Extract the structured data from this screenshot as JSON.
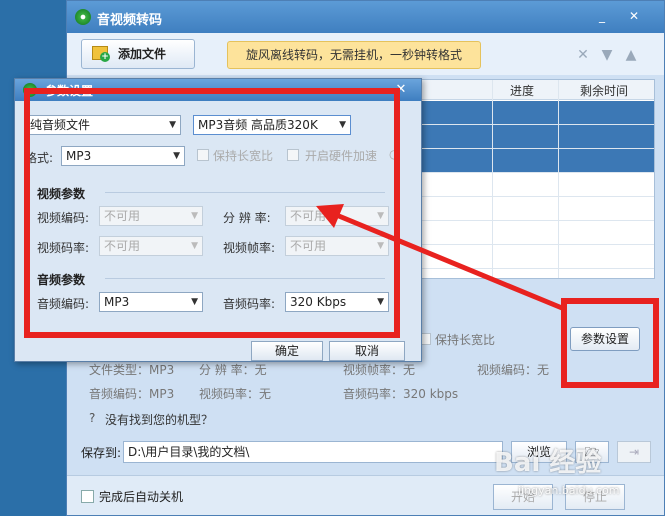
{
  "app": {
    "title": "音视频转码",
    "window_controls": [
      "_",
      "✕"
    ]
  },
  "toolbar": {
    "add_file_label": "添加文件",
    "banner_text": "旋风离线转码，无需挂机，一秒钟转格式",
    "icons": [
      "close-x-icon",
      "arrow-down-icon",
      "arrow-up-icon"
    ]
  },
  "file_grid": {
    "headers": [
      "进度",
      "剩余时间"
    ],
    "selected_rows": 3,
    "total_rows": 8
  },
  "param_panel": {
    "keep_ratio_label": "保持长宽比",
    "paramset_button": "参数设置",
    "line1": [
      "文件类型：MP3",
      "分 辨 率：无",
      "视频帧率：无",
      "视频编码：无"
    ],
    "line2": [
      "音频编码：MP3",
      "视频码率：无",
      "音频码率：320 kbps"
    ],
    "help_text": "没有找到您的机型？"
  },
  "save": {
    "label": "保存到:",
    "path": "D:\\用户目录\\我的文档\\",
    "browse_label": "浏览"
  },
  "bottom": {
    "shutdown_label": "完成后自动关机",
    "start_label": "开始",
    "stop_label": "停止"
  },
  "dialog": {
    "title": "参数设置",
    "close_icon": "✕",
    "format_type": "纯音频文件",
    "preset": "MP3音频 高品质320K",
    "format_label": "格式:",
    "format_value": "MP3",
    "keep_ratio_label": "保持长宽比",
    "hw_accel_label": "开启硬件加速",
    "video_group": "视频参数",
    "video_codec_label": "视频编码:",
    "video_codec_value": "不可用",
    "resolution_label": "分 辨 率:",
    "resolution_value": "不可用",
    "video_bitrate_label": "视频码率:",
    "video_bitrate_value": "不可用",
    "video_fps_label": "视频帧率:",
    "video_fps_value": "不可用",
    "audio_group": "音频参数",
    "audio_codec_label": "音频编码:",
    "audio_codec_value": "MP3",
    "audio_bitrate_label": "音频码率:",
    "audio_bitrate_value": "320 Kbps",
    "ok_label": "确定",
    "cancel_label": "取消"
  },
  "annotation": {
    "color": "#e8221f"
  },
  "watermark": {
    "text": "Bai 经验",
    "sub": "jingyan.baidu.com"
  }
}
